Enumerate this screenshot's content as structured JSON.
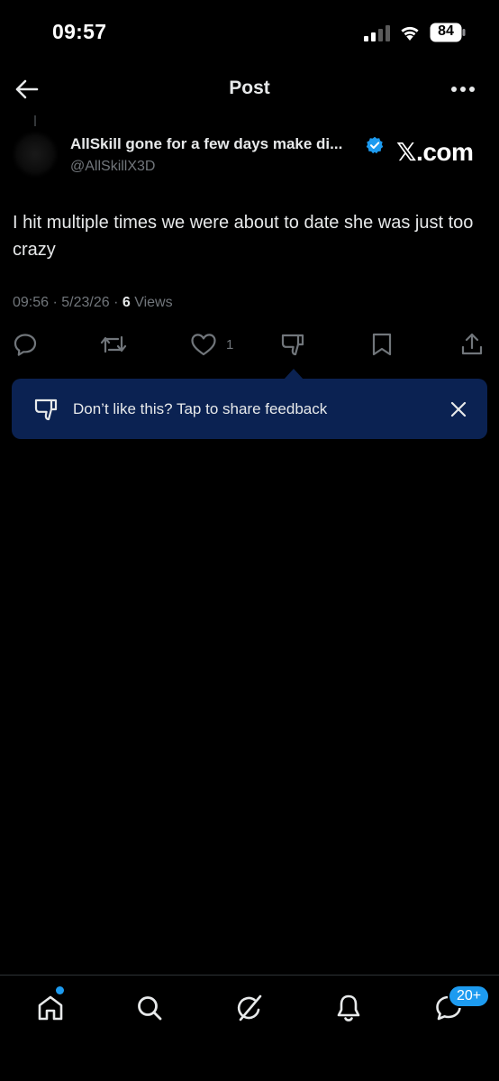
{
  "status_bar": {
    "time": "09:57",
    "battery": "84"
  },
  "header": {
    "title": "Post"
  },
  "post": {
    "author_name": "AllSkill gone for a few days make di...",
    "author_handle": "@AllSkillX3D",
    "source_label": "𝕏.com",
    "text": "I hit multiple times we were about to date she was just too crazy",
    "timestamp": "09:56 · 5/23/26 · ",
    "views_count": "6",
    "views_label": " Views",
    "like_count": "1"
  },
  "feedback_banner": {
    "text": "Don’t like this? Tap to share feedback"
  },
  "bottom_nav": {
    "messages_badge": "20+"
  },
  "colors": {
    "accent": "#1d9bf0",
    "banner_bg": "#0b2252",
    "muted": "#71767b"
  }
}
